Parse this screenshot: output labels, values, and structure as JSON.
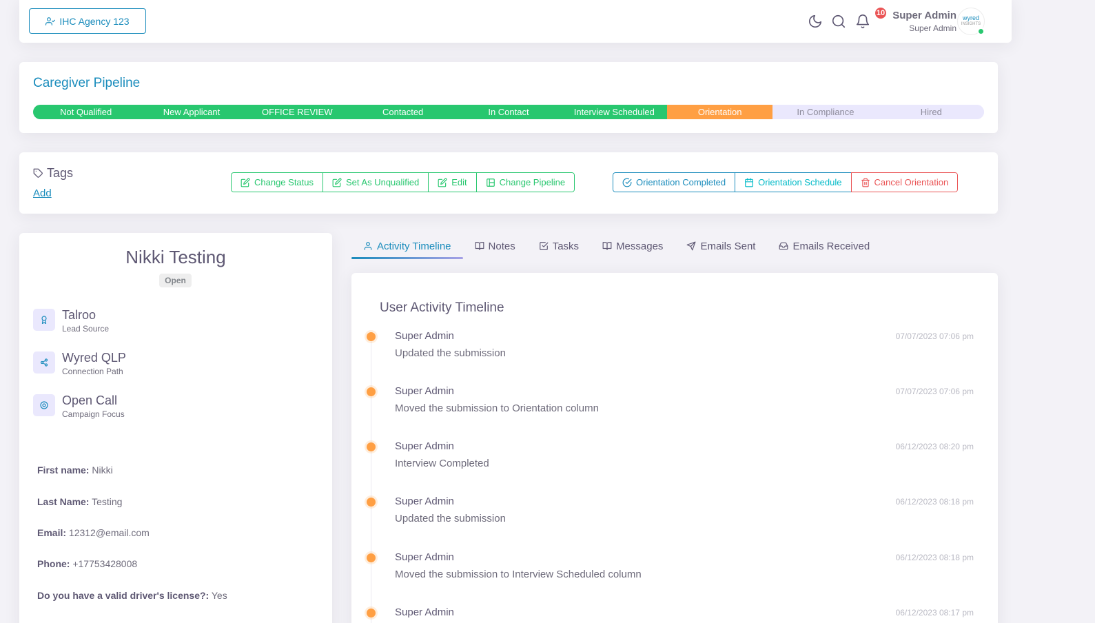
{
  "navbar": {
    "agency_label": "IHC Agency 123",
    "notification_count": "10",
    "user_name": "Super Admin",
    "user_role": "Super Admin",
    "avatar_text": "wyred",
    "avatar_subtext": "INSIGHTS"
  },
  "pipeline": {
    "title": "Caregiver Pipeline",
    "stages": [
      {
        "label": "Not Qualified",
        "state": "done"
      },
      {
        "label": "New Applicant",
        "state": "done"
      },
      {
        "label": "OFFICE REVIEW",
        "state": "done"
      },
      {
        "label": "Contacted",
        "state": "done"
      },
      {
        "label": "In Contact",
        "state": "done"
      },
      {
        "label": "Interview Scheduled",
        "state": "done"
      },
      {
        "label": "Orientation",
        "state": "current"
      },
      {
        "label": "In Compliance",
        "state": "todo"
      },
      {
        "label": "Hired",
        "state": "todo"
      }
    ],
    "colors": {
      "done": "#28c76f",
      "current": "#ff9f43",
      "todo": "#eae8fd"
    }
  },
  "tags": {
    "title": "Tags",
    "add_label": "Add"
  },
  "actions": {
    "change_status": "Change Status",
    "set_unqualified": "Set As Unqualified",
    "edit": "Edit",
    "change_pipeline": "Change Pipeline",
    "orientation_completed": "Orientation Completed",
    "orientation_schedule": "Orientation Schedule",
    "cancel_orientation": "Cancel Orientation"
  },
  "profile": {
    "name": "Nikki Testing",
    "status": "Open",
    "info": [
      {
        "value": "Talroo",
        "label": "Lead Source",
        "icon": "award-icon"
      },
      {
        "value": "Wyred QLP",
        "label": "Connection Path",
        "icon": "share-icon"
      },
      {
        "value": "Open Call",
        "label": "Campaign Focus",
        "icon": "target-icon"
      }
    ],
    "fields": [
      {
        "label": "First name:",
        "value": "Nikki"
      },
      {
        "label": "Last Name:",
        "value": "Testing"
      },
      {
        "label": "Email:",
        "value": "12312@email.com"
      },
      {
        "label": "Phone:",
        "value": "+17753428008"
      },
      {
        "label": "Do you have a valid driver's license?:",
        "value": "Yes"
      }
    ]
  },
  "tabs": [
    {
      "label": "Activity Timeline",
      "icon": "user-icon",
      "active": true
    },
    {
      "label": "Notes",
      "icon": "book-icon"
    },
    {
      "label": "Tasks",
      "icon": "check-square-icon"
    },
    {
      "label": "Messages",
      "icon": "book-open-icon"
    },
    {
      "label": "Emails Sent",
      "icon": "send-icon"
    },
    {
      "label": "Emails Received",
      "icon": "inbox-icon"
    }
  ],
  "timeline": {
    "title": "User Activity Timeline",
    "items": [
      {
        "user": "Super Admin",
        "time": "07/07/2023 07:06 pm",
        "desc": "Updated the submission"
      },
      {
        "user": "Super Admin",
        "time": "07/07/2023 07:06 pm",
        "desc": "Moved the submission to Orientation column"
      },
      {
        "user": "Super Admin",
        "time": "06/12/2023 08:20 pm",
        "desc": "Interview Completed"
      },
      {
        "user": "Super Admin",
        "time": "06/12/2023 08:18 pm",
        "desc": "Updated the submission"
      },
      {
        "user": "Super Admin",
        "time": "06/12/2023 08:18 pm",
        "desc": "Moved the submission to Interview Scheduled column"
      },
      {
        "user": "Super Admin",
        "time": "06/12/2023 08:17 pm",
        "desc": ""
      }
    ],
    "dot_color": "#ff9f43"
  }
}
